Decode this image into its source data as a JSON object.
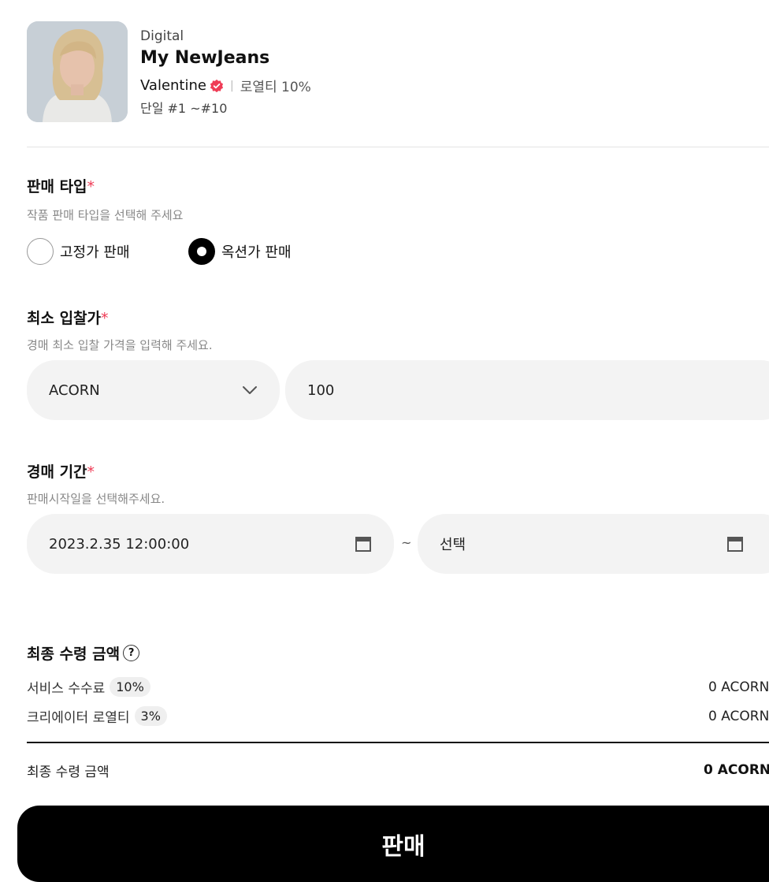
{
  "item": {
    "category": "Digital",
    "title": "My NewJeans",
    "creator": "Valentine",
    "royalty": "로열티 10%",
    "edition": "단일 #1 ~#10"
  },
  "sale_type": {
    "title": "판매 타입",
    "required_mark": "*",
    "desc": "작품 판매 타입을 선택해 주세요",
    "options": [
      {
        "label": "고정가 판매",
        "selected": false
      },
      {
        "label": "옥션가 판매",
        "selected": true
      }
    ]
  },
  "min_bid": {
    "title": "최소 입찰가",
    "required_mark": "*",
    "desc": "경매 최소 입찰 가격을 입력해 주세요.",
    "currency": "ACORN",
    "amount": "100"
  },
  "period": {
    "title": "경매 기간",
    "required_mark": "*",
    "desc": "판매시작일을 선택해주세요.",
    "start": "2023.2.35 12:00:00",
    "separator": "~",
    "end_placeholder": "선택"
  },
  "summary": {
    "title": "최종 수령 금액",
    "help_glyph": "?",
    "service_fee_label": "서비스 수수료",
    "service_fee_pct": "10%",
    "service_fee_amount": "0 ACORN",
    "creator_royalty_label": "크리에이터 로열티",
    "creator_royalty_pct": "3%",
    "creator_royalty_amount": "0 ACORN",
    "total_label": "최종 수령 금액",
    "total_amount": "0 ACORN"
  },
  "submit_label": "판매",
  "colors": {
    "accent_required": "#ef3b55",
    "verified_badge": "#ef3b55",
    "button_bg": "#000000"
  }
}
